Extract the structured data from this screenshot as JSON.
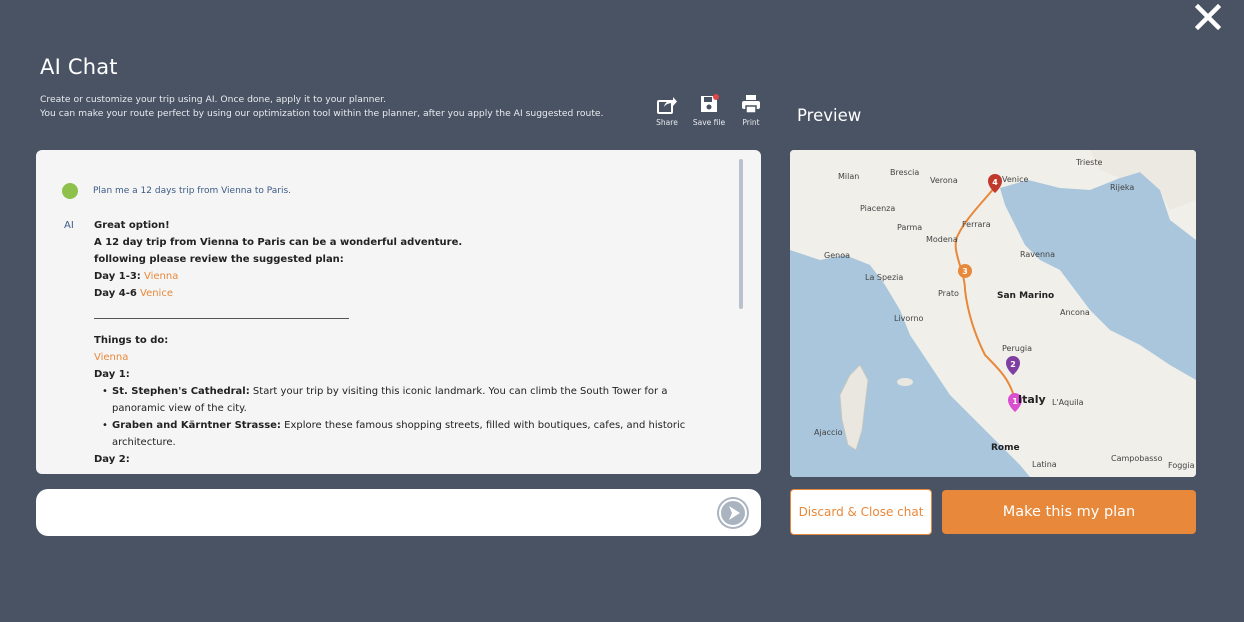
{
  "header": {
    "title": "AI Chat",
    "desc_line1": "Create or customize your trip using AI. Once done, apply it to your planner.",
    "desc_line2": "You can make your route perfect by using our optimization tool within the planner, after you apply the AI suggested route."
  },
  "toolbar": {
    "share_label": "Share",
    "save_label": "Save file",
    "print_label": "Print"
  },
  "preview": {
    "title": "Preview"
  },
  "chat": {
    "user_message": "Plan me a 12 days trip from Vienna to Paris.",
    "ai_label": "AI",
    "ai_intro1": "Great option!",
    "ai_intro2": "A 12 day trip from Vienna to Paris can be a wonderful adventure.",
    "ai_intro3": "following please review the suggested plan:",
    "day_ranges": [
      {
        "label": "Day 1-3:",
        "city": "Vienna"
      },
      {
        "label": "Day 4-6",
        "city": "Venice"
      }
    ],
    "things_title": "Things to do:",
    "things_city": "Vienna",
    "day1_label": "Day 1:",
    "day1_items": [
      {
        "name": "St. Stephen's Cathedral:",
        "text": "Start your trip by visiting this iconic landmark. You can climb the South Tower for a",
        "text2": "panoramic view of the city."
      },
      {
        "name": "Graben and Kärntner Strasse:",
        "text": "Explore these famous shopping streets, filled with boutiques, cafes, and historic",
        "text2": "architecture."
      }
    ],
    "day2_label": "Day 2:"
  },
  "input": {
    "value": "",
    "placeholder": ""
  },
  "map": {
    "cities": [
      "Trieste",
      "Milan",
      "Brescia",
      "Verona",
      "Venice",
      "Rijeka",
      "Piacenza",
      "Parma",
      "Modena",
      "Ferrara",
      "Genoa",
      "La Spezia",
      "Ravenna",
      "Prato",
      "San Marino",
      "Livorno",
      "Ancona",
      "Perugia",
      "Italy",
      "L'Aquila",
      "Ajaccio",
      "Rome",
      "Latina",
      "Campobasso",
      "Foggia"
    ],
    "markers": [
      "1",
      "2",
      "3",
      "4"
    ],
    "route_color": "#e8883a"
  },
  "buttons": {
    "discard": "Discard & Close chat",
    "make_plan": "Make this my plan"
  },
  "colors": {
    "accent": "#e8883a",
    "background": "#4a5363",
    "user_dot": "#8dc14b"
  }
}
